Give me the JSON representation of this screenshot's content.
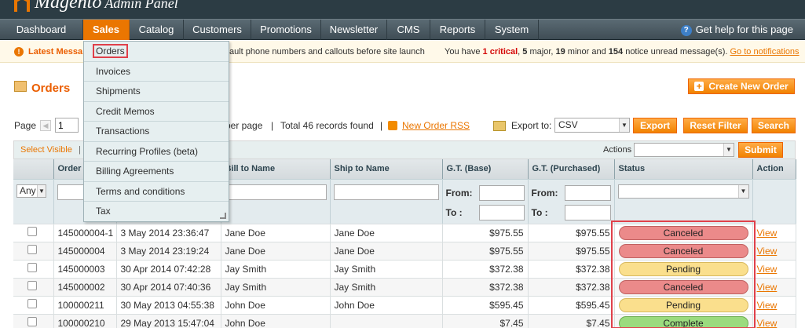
{
  "header": {
    "logo_text": "Magento",
    "logo_sub": "Admin Panel"
  },
  "nav": {
    "items": [
      {
        "label": "Dashboard"
      },
      {
        "label": "Sales"
      },
      {
        "label": "Catalog"
      },
      {
        "label": "Customers"
      },
      {
        "label": "Promotions"
      },
      {
        "label": "Newsletter"
      },
      {
        "label": "CMS"
      },
      {
        "label": "Reports"
      },
      {
        "label": "System"
      }
    ],
    "active": "Sales",
    "help_label": "Get help for this page"
  },
  "notice": {
    "latest_label": "Latest Messa",
    "behind_text": "ault phone numbers and callouts before site launch",
    "msgs_prefix": "You have ",
    "critical_count": "1 critical",
    "major": "5",
    "major_suffix": " major, ",
    "minor": "19",
    "minor_suffix": " minor and ",
    "notice_count": "154",
    "notice_suffix": " notice unread message(s).",
    "link": "Go to notifications"
  },
  "sales_menu": {
    "items": [
      {
        "label": "Orders"
      },
      {
        "label": "Invoices"
      },
      {
        "label": "Shipments"
      },
      {
        "label": "Credit Memos"
      },
      {
        "label": "Transactions"
      },
      {
        "label": "Recurring Profiles (beta)"
      },
      {
        "label": "Billing Agreements"
      },
      {
        "label": "Terms and conditions"
      },
      {
        "label": "Tax"
      }
    ]
  },
  "page": {
    "title": "Orders",
    "create_button": "Create New Order",
    "create_plus": "+"
  },
  "pager": {
    "page_label": "Page",
    "page_value": "1",
    "per_page_label": "per page",
    "sep": "|",
    "total": "Total 46 records found",
    "rss_link": "New Order RSS",
    "export_label": "Export to:",
    "export_value": "CSV",
    "export_button": "Export",
    "reset_button": "Reset Filter",
    "search_button": "Search"
  },
  "massaction": {
    "select_visible": "Select Visible",
    "sep": "|",
    "actions_label": "Actions",
    "submit_button": "Submit"
  },
  "grid": {
    "columns": [
      "",
      "Order",
      "",
      "Bill to Name",
      "Ship to Name",
      "G.T. (Base)",
      "G.T. (Purchased)",
      "Status",
      "Action"
    ],
    "filter": {
      "any": "Any",
      "from": "From:",
      "to": "To :"
    },
    "rows": [
      {
        "order": "145000004-1",
        "date": "3 May 2014 23:36:47",
        "bill": "Jane Doe",
        "ship": "Jane Doe",
        "base": "$975.55",
        "purchased": "$975.55",
        "status": "Canceled",
        "action": "View"
      },
      {
        "order": "145000004",
        "date": "3 May 2014 23:19:24",
        "bill": "Jane Doe",
        "ship": "Jane Doe",
        "base": "$975.55",
        "purchased": "$975.55",
        "status": "Canceled",
        "action": "View"
      },
      {
        "order": "145000003",
        "date": "30 Apr 2014 07:42:28",
        "bill": "Jay Smith",
        "ship": "Jay Smith",
        "base": "$372.38",
        "purchased": "$372.38",
        "status": "Pending",
        "action": "View"
      },
      {
        "order": "145000002",
        "date": "30 Apr 2014 07:40:36",
        "bill": "Jay Smith",
        "ship": "Jay Smith",
        "base": "$372.38",
        "purchased": "$372.38",
        "status": "Canceled",
        "action": "View"
      },
      {
        "order": "100000211",
        "date": "30 May 2013 04:55:38",
        "bill": "John Doe",
        "ship": "John Doe",
        "base": "$595.45",
        "purchased": "$595.45",
        "status": "Pending",
        "action": "View"
      },
      {
        "order": "100000210",
        "date": "29 May 2013 15:47:04",
        "bill": "John Doe",
        "ship": "",
        "base": "$7.45",
        "purchased": "$7.45",
        "status": "Complete",
        "action": "View"
      }
    ]
  },
  "colors": {
    "accent": "#ea7601",
    "header_bg": "#2c3c44",
    "canceled": "#eb8a8a",
    "pending": "#fadf8d",
    "complete": "#9bdb7e",
    "highlight": "#e0404a"
  }
}
